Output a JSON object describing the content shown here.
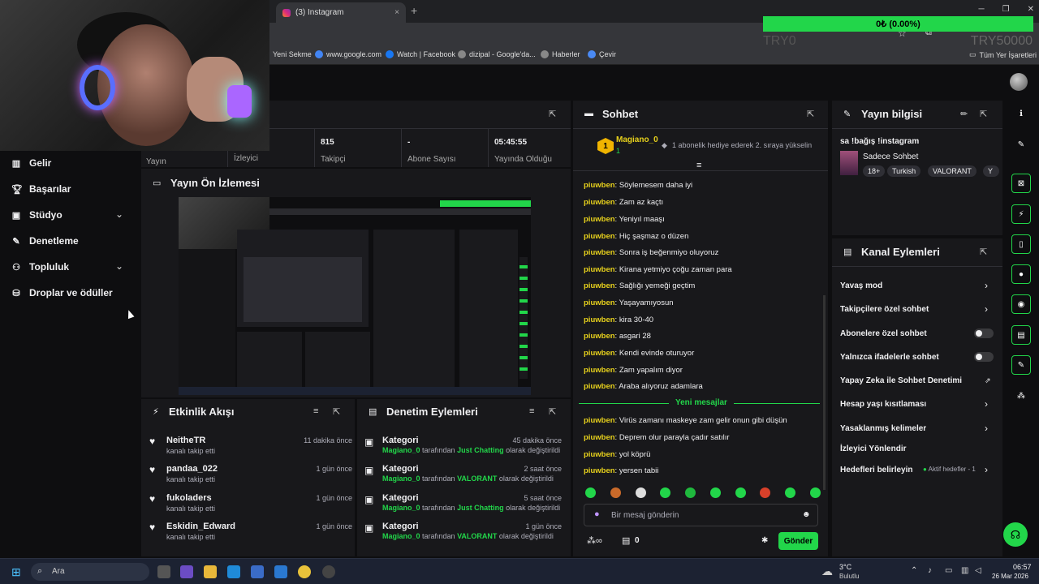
{
  "browser": {
    "tab_title": "(3) Instagram",
    "tab_close": "×",
    "new_tab": "+",
    "win_min": "─",
    "win_max": "❐",
    "win_close": "✕",
    "bookmarks": [
      {
        "label": "Yeni Sekme"
      },
      {
        "label": "www.google.com"
      },
      {
        "label": "Watch | Facebook"
      },
      {
        "label": "dizipal - Google'da..."
      },
      {
        "label": "Haberler"
      },
      {
        "label": "Çevir"
      }
    ],
    "all_bookmarks": "Tüm Yer İşaretleri"
  },
  "overlay": {
    "progress_text": "0₺ (0.00%)",
    "progress_fraction": 0.0,
    "goal_left": "TRY0",
    "goal_right": "TRY50000"
  },
  "sidebar": {
    "items": [
      {
        "label": "Gelir",
        "icon": "chart-icon"
      },
      {
        "label": "Başarılar",
        "icon": "trophy-icon"
      },
      {
        "label": "Stüdyo",
        "icon": "studio-icon"
      },
      {
        "label": "Denetleme",
        "icon": "wrench-icon"
      },
      {
        "label": "Topluluk",
        "icon": "people-icon"
      },
      {
        "label": "Droplar ve ödüller",
        "icon": "drops-icon"
      }
    ]
  },
  "stats": {
    "items": [
      {
        "value": "",
        "label": "Yayın"
      },
      {
        "value": "",
        "label": "İzleyici"
      },
      {
        "value": "815",
        "label": "Takipçi"
      },
      {
        "value": "-",
        "label": "Abone Sayısı"
      },
      {
        "value": "05:45:55",
        "label": "Yayında Olduğu"
      }
    ]
  },
  "preview": {
    "title": "Yayın Ön İzlemesi"
  },
  "activity": {
    "title": "Etkinlik Akışı",
    "items": [
      {
        "name": "NeitheTR",
        "desc": "kanalı takip etti",
        "time": "11 dakika önce"
      },
      {
        "name": "pandaa_022",
        "desc": "kanalı takip etti",
        "time": "1 gün önce"
      },
      {
        "name": "fukoladers",
        "desc": "kanalı takip etti",
        "time": "1 gün önce"
      },
      {
        "name": "Eskidin_Edward",
        "desc": "kanalı takip etti",
        "time": "1 gün önce"
      }
    ]
  },
  "moderation": {
    "title": "Denetim Eylemleri",
    "items": [
      {
        "name": "Kategori",
        "time": "45 dakika önce",
        "user": "Magiano_0",
        "mid": " tarafından ",
        "category": "Just Chatting",
        "end": " olarak değiştirildi"
      },
      {
        "name": "Kategori",
        "time": "2 saat önce",
        "user": "Magiano_0",
        "mid": " tarafından ",
        "category": "VALORANT",
        "end": " olarak değiştirildi"
      },
      {
        "name": "Kategori",
        "time": "5 saat önce",
        "user": "Magiano_0",
        "mid": " tarafından ",
        "category": "Just Chatting",
        "end": " olarak değiştirildi"
      },
      {
        "name": "Kategori",
        "time": "1 gün önce",
        "user": "Magiano_0",
        "mid": " tarafından ",
        "category": "VALORANT",
        "end": " olarak değiştirildi"
      }
    ]
  },
  "chat": {
    "title": "Sohbet",
    "pinned_user": "Magiano_0",
    "pinned_badge": "1",
    "pinned_count": "1",
    "pinned_text": "1 abonelik hediye ederek 2. sıraya yükselin",
    "messages": [
      {
        "user": "piuwben",
        "text": "Söylemesem daha iyi"
      },
      {
        "user": "piuwben",
        "text": "Zam az kaçtı"
      },
      {
        "user": "piuwben",
        "text": "Yeniyıl maaşı"
      },
      {
        "user": "piuwben",
        "text": "Hiç şaşmaz o düzen"
      },
      {
        "user": "piuwben",
        "text": "Sonra iş beğenmiyo oluyoruz"
      },
      {
        "user": "piuwben",
        "text": "Kirana yetmiyo çoğu zaman para"
      },
      {
        "user": "piuwben",
        "text": "Sağlığı yemeği geçtim"
      },
      {
        "user": "piuwben",
        "text": "Yaşayamıyosun"
      },
      {
        "user": "piuwben",
        "text": "kira 30-40"
      },
      {
        "user": "piuwben",
        "text": "asgari 28"
      },
      {
        "user": "piuwben",
        "text": "Kendi evinde oturuyor"
      },
      {
        "user": "piuwben",
        "text": "Zam yapalım diyor"
      },
      {
        "user": "piuwben",
        "text": "Araba alıyoruz adamlara"
      }
    ],
    "new_messages": "Yeni mesajlar",
    "new": [
      {
        "user": "piuwben",
        "text": "Virüs zamanı maskeye zam gelir onun gibi düşün"
      },
      {
        "user": "piuwben",
        "text": "Deprem olur parayla çadır satılır"
      },
      {
        "user": "piuwben",
        "text": "yol köprü"
      },
      {
        "user": "piuwben",
        "text": "yersen tabii"
      }
    ],
    "placeholder": "Bir mesaj gönderin",
    "points": "0",
    "send": "Gönder"
  },
  "stream_info": {
    "title": "Yayın bilgisi",
    "stream_title": "sa !bağış !instagram",
    "category": "Sadece Sohbet",
    "tags": [
      "18+",
      "Turkish",
      "VALORANT",
      "Y"
    ]
  },
  "channel_actions": {
    "title": "Kanal Eylemleri",
    "items": [
      {
        "label": "Yavaş mod"
      },
      {
        "label": "Takipçilere özel sohbet"
      },
      {
        "label": "Abonelere özel sohbet"
      },
      {
        "label": "Yalnızca ifadelerle sohbet"
      },
      {
        "label": "Yapay Zeka ile Sohbet Denetimi"
      },
      {
        "label": "Hesap yaşı kısıtlaması"
      },
      {
        "label": "Yasaklanmış kelimeler"
      },
      {
        "label": "İzleyici Yönlendir"
      },
      {
        "label": "Hedefleri belirleyin"
      }
    ],
    "active_goals": "Aktif hedefler - 1"
  },
  "taskbar": {
    "search": "Ara",
    "weather_temp": "3°C",
    "weather_desc": "Bulutlu",
    "time": "06:57",
    "date": "26 Mar 2026"
  },
  "colors": {
    "accent": "#22d64a",
    "bg": "#0e0e10",
    "panel": "#18181b",
    "username": "#e7d11c"
  }
}
